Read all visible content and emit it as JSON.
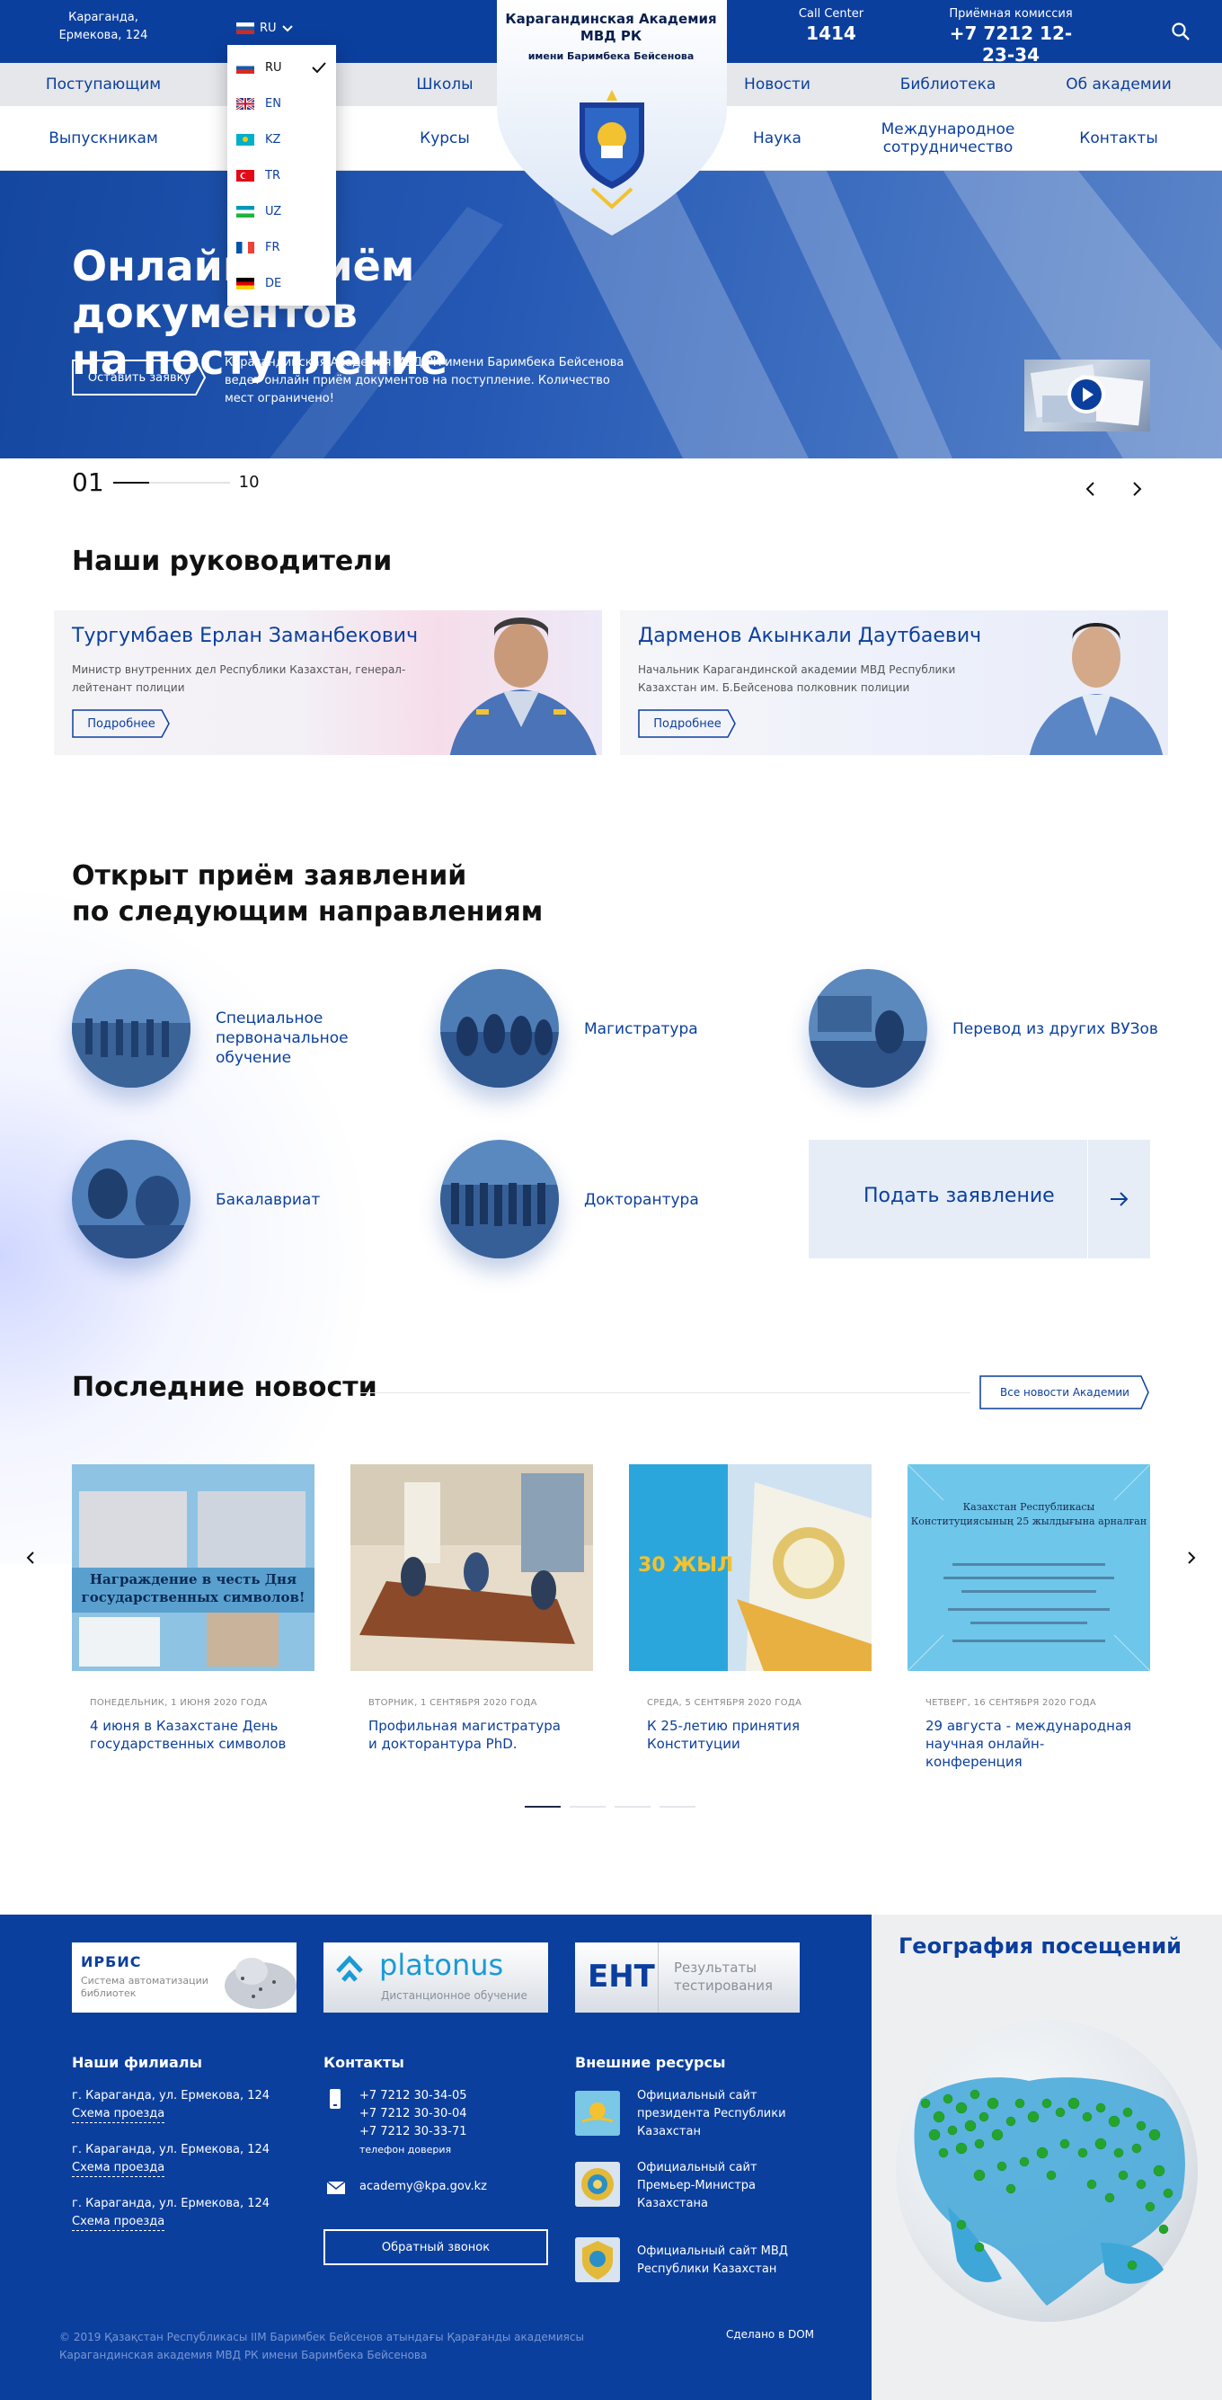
{
  "topbar": {
    "address": "Караганда,\nЕрмекова, 124",
    "lang_current": "RU",
    "call_center_label": "Call Center",
    "call_center_value": "1414",
    "admission_label": "Приёмная комиссия",
    "admission_value": "+7 7212 12-23-34"
  },
  "logo": {
    "title": "Карагандинская Академия\nМВД РК",
    "subtitle": "имени Баримбека Бейсенова"
  },
  "lang_menu": [
    {
      "code": "RU",
      "colors": [
        "#ffffff",
        "#1c57a7",
        "#d52b1e"
      ],
      "current": true
    },
    {
      "code": "EN",
      "colors": [
        "#1b3b87",
        "#ffffff",
        "#c8102e"
      ],
      "current": false
    },
    {
      "code": "KZ",
      "colors": [
        "#00afca",
        "#00afca",
        "#fec50c"
      ],
      "current": false
    },
    {
      "code": "TR",
      "colors": [
        "#e30a17",
        "#e30a17",
        "#ffffff"
      ],
      "current": false
    },
    {
      "code": "UZ",
      "colors": [
        "#1eb53a",
        "#ffffff",
        "#0099b5"
      ],
      "current": false
    },
    {
      "code": "FR",
      "colors": [
        "#0055a4",
        "#ffffff",
        "#ef4135"
      ],
      "current": false
    },
    {
      "code": "DE",
      "colors": [
        "#000000",
        "#dd0000",
        "#ffce00"
      ],
      "current": false
    }
  ],
  "nav_top": [
    "Поступающим",
    "Школы",
    "Новости",
    "Библиотека",
    "Об академии"
  ],
  "nav_bottom": [
    "Выпускникам",
    "Курсы",
    "Наука",
    "Международное\nсотрудничество",
    "Контакты"
  ],
  "hero": {
    "title": "Онлайн приём документов\nна поступление",
    "button": "Оставить заявку",
    "text": "Карагандинская Академия МВД РК имени Баримбека Бейсенова ведет онлайн приём документов на поступление. Количество мест ограничено!",
    "slide_current": "01",
    "slide_total": "10"
  },
  "leaders": {
    "heading": "Наши руководители",
    "items": [
      {
        "name": "Тургумбаев Ерлан Заманбекович",
        "role": "Министр внутренних дел Республики Казахстан, генерал-лейтенант полиции",
        "button": "Подробнее"
      },
      {
        "name": "Дарменов Акынкали Даутбаевич",
        "role": "Начальник Карагандинской академии МВД Республики Казахстан им. Б.Бейсенова полковник полиции",
        "button": "Подробнее"
      }
    ]
  },
  "directions": {
    "heading": "Открыт приём заявлений\nпо следующим направлениям",
    "items": [
      "Специальное\nпервоначальное обучение",
      "Магистратура",
      "Перевод из других ВУЗов",
      "Бакалавриат",
      "Докторантура"
    ],
    "apply": "Подать заявление"
  },
  "news": {
    "heading": "Последние новости",
    "all_button": "Все новости Академии",
    "items": [
      {
        "date": "ПОНЕДЕЛЬНИК, 1 ИЮНЯ 2020 ГОДА",
        "title": "4 июня в Казахстане День\nгосударственных символов",
        "img_caption": "Награждение в честь Дня\nгосударственных символов!"
      },
      {
        "date": "ВТОРНИК, 1 СЕНТЯБРЯ 2020 ГОДА",
        "title": "Профильная магистратура\nи докторантура PhD.",
        "img_caption": ""
      },
      {
        "date": "СРЕДА, 5 СЕНТЯБРЯ 2020 ГОДА",
        "title": "К 25-летию принятия\nКонституции",
        "img_caption": "30 ЖЫЛ"
      },
      {
        "date": "ЧЕТВЕРГ, 16 СЕНТЯБРЯ 2020 ГОДА",
        "title": "29 августа - международная\nнаучная онлайн-конференция",
        "img_caption": "Казахстан Республикасы\nКонституциясының 25 жылдығына арналған"
      }
    ]
  },
  "footer": {
    "logos": [
      {
        "name": "ИРБИС",
        "sub": "Система автоматизации\nбиблиотек"
      },
      {
        "name": "platonus",
        "sub": "Дистанционное обучение"
      },
      {
        "name": "ЕНТ",
        "sub": "Результаты\nтестирования"
      }
    ],
    "branches_heading": "Наши филиалы",
    "branches": [
      {
        "address": "г. Караганда, ул. Ермекова, 124",
        "link": "Схема проезда"
      },
      {
        "address": "г. Караганда, ул. Ермекова, 124",
        "link": "Схема проезда"
      },
      {
        "address": "г. Караганда, ул. Ермекова, 124",
        "link": "Схема проезда"
      }
    ],
    "contacts_heading": "Контакты",
    "phones": [
      "+7 7212 30-34-05",
      "+7 7212 30-30-04",
      "+7 7212 30-33-71"
    ],
    "phone_note": "телефон доверия",
    "email": "academy@kpa.gov.kz",
    "callback": "Обратный звонок",
    "resources_heading": "Внешние ресурсы",
    "resources": [
      "Официальный сайт\nпрезидента Республики\nКазахстан",
      "Официальный сайт\nПремьер-Министра\nКазахстана",
      "Официальный сайт МВД\nРеспублики Казахстан"
    ],
    "copyright": "© 2019 Қазақстан Республикасы ІІМ Баримбек Бейсенов атындағы Қарағанды академиясы\nКарагандинская академия МВД РК имени Баримбека Бейсенова",
    "made_by": "Сделано в DOM",
    "map_title": "География посещений"
  }
}
